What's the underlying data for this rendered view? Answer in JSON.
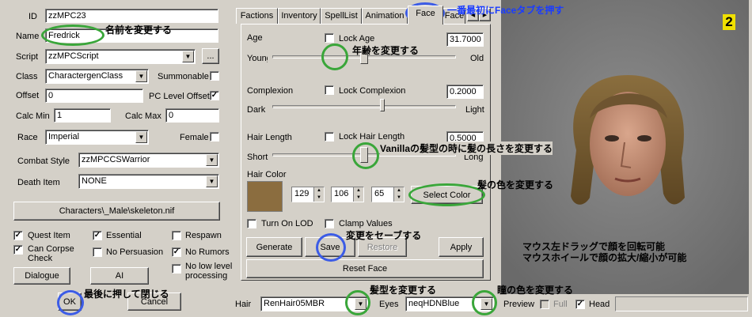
{
  "left": {
    "id_label": "ID",
    "id_value": "zzMPC23",
    "name_label": "Name",
    "name_value": "Fredrick",
    "script_label": "Script",
    "script_value": "zzMPCScript",
    "script_more": "...",
    "class_label": "Class",
    "class_value": "CharactergenClass",
    "summonable_label": "Summonable",
    "offset_label": "Offset",
    "offset_value": "0",
    "pc_level_offset_label": "PC Level Offset",
    "pc_level_offset_check": "✓",
    "calc_min_label": "Calc Min",
    "calc_min_value": "1",
    "calc_max_label": "Calc Max",
    "calc_max_value": "0",
    "race_label": "Race",
    "race_value": "Imperial",
    "female_label": "Female",
    "combat_style_label": "Combat Style",
    "combat_style_value": "zzMPCCSWarrior",
    "death_item_label": "Death Item",
    "death_item_value": "NONE",
    "skeleton_button": "Characters\\_Male\\skeleton.nif",
    "flags": {
      "quest_item": "Quest Item",
      "quest_item_check": "✓",
      "essential": "Essential",
      "essential_check": "✓",
      "respawn": "Respawn",
      "can_corpse_check": "Can Corpse Check",
      "can_corpse_check_check": "✓",
      "no_persuasion": "No Persuasion",
      "no_rumors": "No Rumors",
      "no_rumors_check": "✓",
      "no_low_level_processing": "No low level processing"
    },
    "dialogue_button": "Dialogue",
    "ai_button": "AI",
    "ok_button": "OK",
    "cancel_button": "Cancel"
  },
  "tabs": [
    "Factions",
    "Inventory",
    "SpellList",
    "Animation",
    "Face",
    "Face"
  ],
  "tab_scroll_left": "◀",
  "tab_scroll_right": "▶",
  "face": {
    "age_label": "Age",
    "lock_age": "Lock Age",
    "age_value": "31.7000",
    "age_min": "Young",
    "age_max": "Old",
    "age_level": 0.5,
    "complexion_label": "Complexion",
    "lock_complexion": "Lock Complexion",
    "complexion_value": "0.2000",
    "complexion_min": "Dark",
    "complexion_max": "Light",
    "complexion_level": 0.6,
    "hair_length_label": "Hair Length",
    "lock_hair_length": "Lock Hair Length",
    "hair_length_value": "0.5000",
    "hair_length_min": "Short",
    "hair_length_max": "Long",
    "hair_length_level": 0.5,
    "hair_color_label": "Hair Color",
    "hair_color_hex": "#8b6d3f",
    "hair_r": "129",
    "hair_g": "106",
    "hair_b": "65",
    "select_color_button": "Select Color",
    "turn_on_lod": "Turn On LOD",
    "clamp_values": "Clamp Values",
    "generate_button": "Generate",
    "save_button": "Save",
    "restore_button": "Restore",
    "apply_button": "Apply",
    "reset_face_button": "Reset Face"
  },
  "bottom": {
    "hair_label": "Hair",
    "hair_value": "RenHair05MBR",
    "eyes_label": "Eyes",
    "eyes_value": "neqHDNBlue",
    "preview_label": "Preview",
    "full_label": "Full",
    "head_label": "Head",
    "head_check": "✓"
  },
  "page_marker": "2",
  "annotations": {
    "face_tab": "一番最初にFaceタブを押す",
    "name": "名前を変更する",
    "age": "年齢を変更する",
    "hair_length": "Vanillaの髪型の時に髪の長さを変更する",
    "hair_color": "髪の色を変更する",
    "save": "変更をセーブする",
    "preview_1": "マウス左ドラッグで顔を回転可能",
    "preview_2": "マウスホイールで顔の拡大/縮小が可能",
    "ok": "最後に押して閉じる",
    "hair": "髪型を変更する",
    "eyes": "瞳の色を変更する"
  },
  "colors": {
    "annotation_ring_green": "#3aa63a",
    "annotation_ring_blue": "#3c5ce6",
    "annotation_text_blue": "#1a3cff"
  }
}
